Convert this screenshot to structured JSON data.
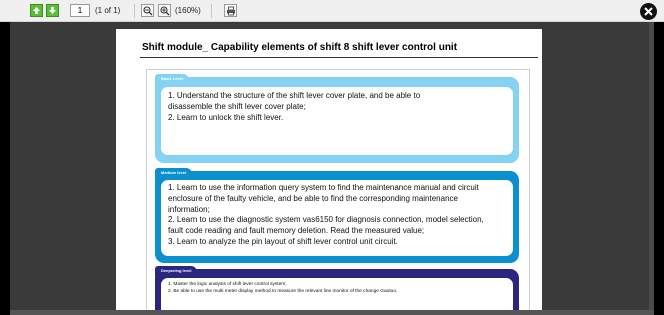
{
  "toolbar": {
    "page_value": "1",
    "page_count": "(1 of 1)",
    "zoom": "(160%)"
  },
  "icons": {
    "prev": "arrow-up-icon",
    "next": "arrow-down-icon",
    "zoom_out": "zoom-out-icon",
    "zoom_in": "zoom-in-icon",
    "print": "print-icon",
    "close": "close-icon"
  },
  "colors": {
    "basic_level": "#85d3f3",
    "medium_level": "#0a8fcf",
    "deepening_level": "#2a2680"
  },
  "document": {
    "title": "Shift module_ Capability elements of shift 8 shift lever control unit",
    "levels": [
      {
        "tab": "Basic Level",
        "lines": [
          "1. Understand the structure of the shift lever cover plate, and be able to",
          "disassemble the shift lever cover plate;",
          "2. Learn to unlock the shift lever."
        ]
      },
      {
        "tab": "Medium level",
        "lines": [
          "1. Learn to use the information query system to find the maintenance manual and circuit",
          "enclosure of the faulty vehicle, and be able to find the corresponding maintenance",
          "information;",
          "2. Learn to use the diagnostic system vas6150 for diagnosis connection, model selection,",
          "fault code reading and fault memory deletion. Read the measured value;",
          "3. Learn to analyze the pin layout of shift lever control unit circuit."
        ]
      },
      {
        "tab": "Deepening level",
        "lines": [
          "1. Master the logic analysis of shift lever control system;",
          "2. Be able to use the multi meter display method to measure the relevant line monitor of the change Gaotuo."
        ]
      }
    ]
  }
}
